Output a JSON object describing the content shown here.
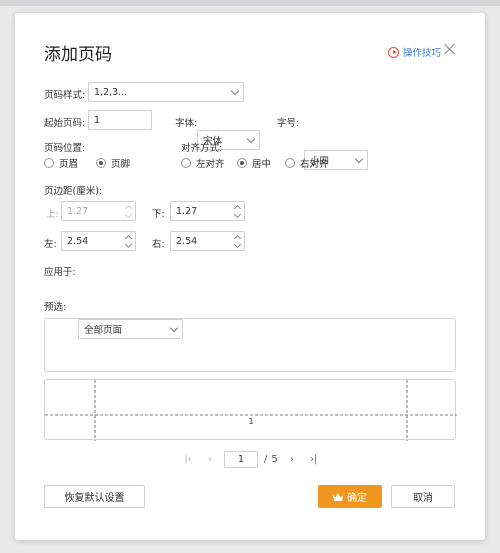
{
  "dialog": {
    "title": "添加页码",
    "tips_label": "操作技巧"
  },
  "style": {
    "label": "页码样式:",
    "value": "1,2,3..."
  },
  "start": {
    "label": "起始页码:",
    "value": "1"
  },
  "font": {
    "label": "字体:",
    "value": "宋体"
  },
  "size": {
    "label": "字号:",
    "value": "小四"
  },
  "position": {
    "label": "页码位置:",
    "options": [
      {
        "label": "页眉",
        "selected": false
      },
      {
        "label": "页脚",
        "selected": true
      }
    ]
  },
  "align": {
    "label": "对齐方式:",
    "options": [
      {
        "label": "左对齐",
        "selected": false
      },
      {
        "label": "居中",
        "selected": true
      },
      {
        "label": "右对齐",
        "selected": false
      }
    ]
  },
  "margins": {
    "label": "页边距(厘米):",
    "top_label": "上:",
    "top_value": "1.27",
    "bottom_label": "下:",
    "bottom_value": "1.27",
    "left_label": "左:",
    "left_value": "2.54",
    "right_label": "右:",
    "right_value": "2.54"
  },
  "apply": {
    "label": "应用于:",
    "value": "全部页面"
  },
  "preview": {
    "label": "预选:",
    "page_number": "1"
  },
  "pager": {
    "current": "1",
    "separator": "/",
    "total": "5"
  },
  "buttons": {
    "restore": "恢复默认设置",
    "ok": "确定",
    "cancel": "取消"
  },
  "colors": {
    "primary": "#f0971f",
    "link": "#3b7ddd",
    "tips_icon": "#e04b3a"
  }
}
